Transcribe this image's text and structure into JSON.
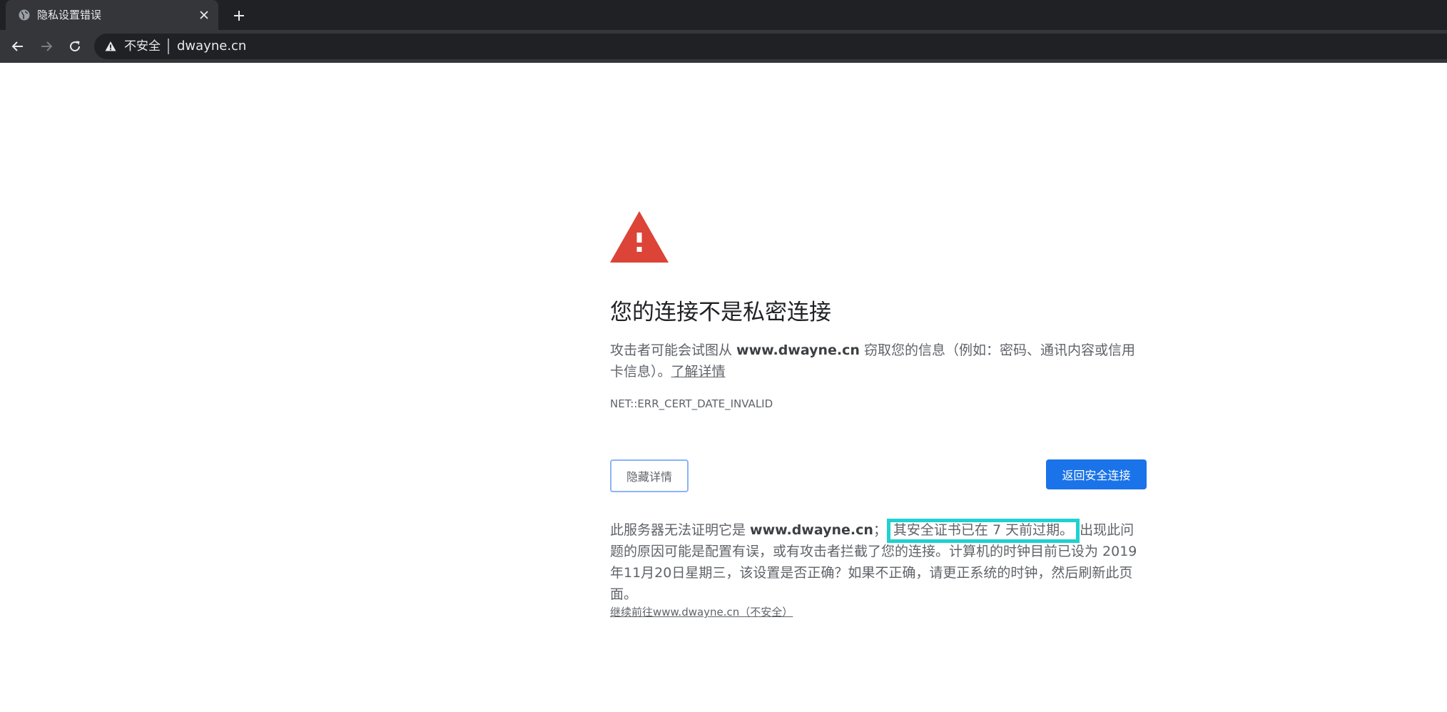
{
  "browser": {
    "tab": {
      "title": "隐私设置错误",
      "favicon": "globe-icon",
      "close_icon": "close-icon"
    },
    "new_tab_icon": "plus-icon",
    "nav": {
      "back_icon": "arrow-left-icon",
      "forward_icon": "arrow-right-icon",
      "reload_icon": "reload-icon"
    },
    "omnibox": {
      "warning_icon": "warning-icon",
      "status": "不安全",
      "url": "dwayne.cn"
    },
    "colors": {
      "tabstrip": "#202124",
      "toolbar": "#35363a",
      "omnibox": "#202124"
    }
  },
  "page": {
    "warning_icon": "red-warning-triangle-icon",
    "heading": "您的连接不是私密连接",
    "explanation": {
      "before": "攻击者可能会试图从 ",
      "domain": "www.dwayne.cn",
      "after": " 窃取您的信息（例如：密码、通讯内容或信用卡信息）。",
      "learn_more": "了解详情"
    },
    "error_code": "NET::ERR_CERT_DATE_INVALID",
    "buttons": {
      "details": "隐藏详情",
      "back_to_safety": "返回安全连接"
    },
    "details": {
      "before": "此服务器无法证明它是 ",
      "domain": "www.dwayne.cn",
      "punct": "；",
      "highlighted": "其安全证书已在 7 天前过期。",
      "after": "出现此问题的原因可能是配置有误，或有攻击者拦截了您的连接。计算机的时钟目前已设为 2019年11月20日星期三，该设置是否正确？如果不正确，请更正系统的时钟，然后刷新此页面。"
    },
    "proceed_link": "继续前往www.dwayne.cn（不安全）",
    "colors": {
      "warning_red": "#db4437",
      "primary_button": "#1a73e8",
      "highlight_box": "#1fd1d1"
    }
  }
}
